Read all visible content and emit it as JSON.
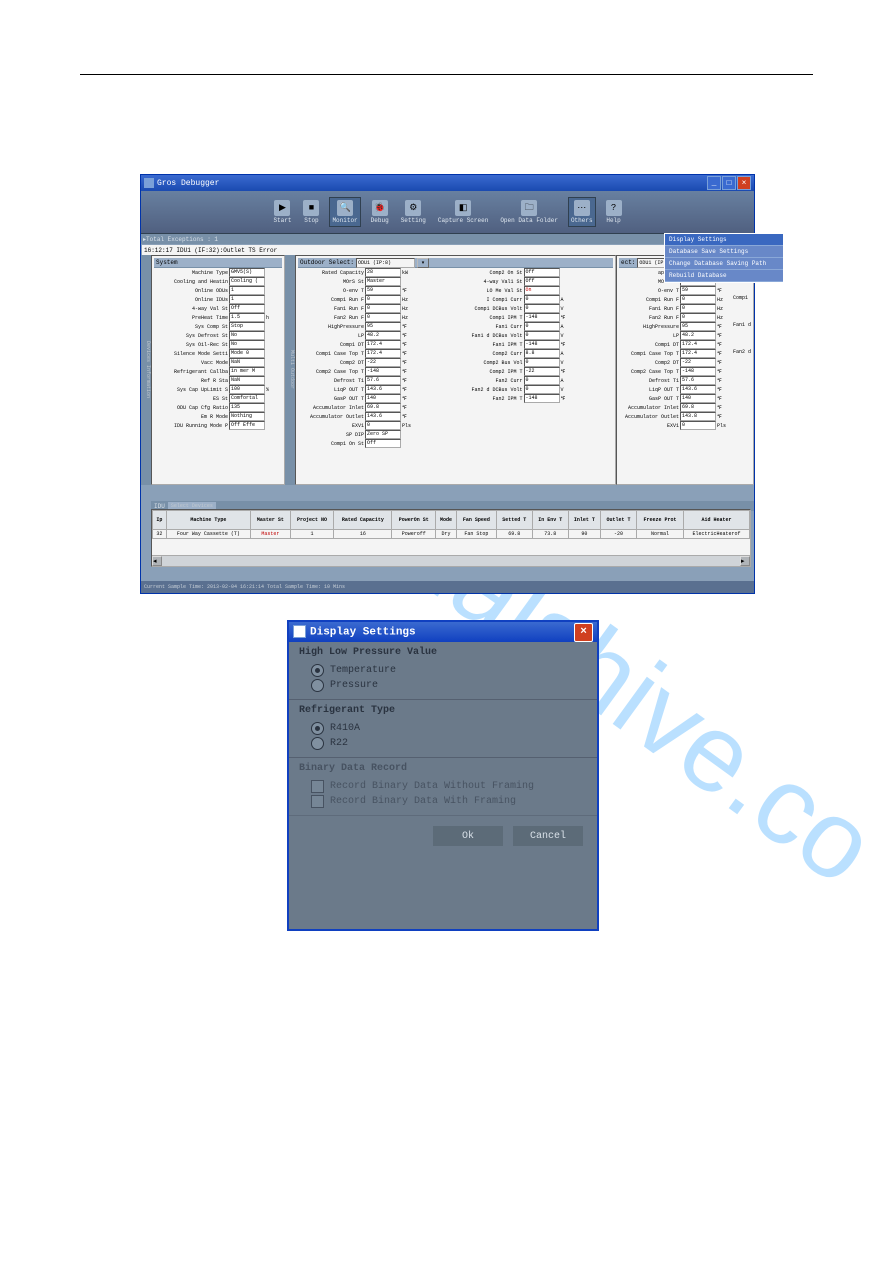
{
  "app": {
    "title": "Gros Debugger",
    "title_icon": "app-icon"
  },
  "winbtns": {
    "min": "_",
    "max": "□",
    "close": "×"
  },
  "toolbar": [
    {
      "key": "start",
      "label": "Start",
      "glyph": "▶"
    },
    {
      "key": "stop",
      "label": "Stop",
      "glyph": "■"
    },
    {
      "key": "monitor",
      "label": "Monitor",
      "glyph": "🔍",
      "selected": true
    },
    {
      "key": "debug",
      "label": "Debug",
      "glyph": "🐞"
    },
    {
      "key": "setting",
      "label": "Setting",
      "glyph": "⚙"
    },
    {
      "key": "capture",
      "label": "Capture Screen",
      "glyph": "◧"
    },
    {
      "key": "open",
      "label": "Open Data Folder",
      "glyph": "🗀"
    },
    {
      "key": "others",
      "label": "Others",
      "glyph": "⋯",
      "selected": true
    },
    {
      "key": "help",
      "label": "Help",
      "glyph": "?"
    }
  ],
  "exc": {
    "label": "Total Exceptions : 1",
    "msg": "16:12:17 IDU1 (IF:32):Outlet TS Error"
  },
  "menu": [
    {
      "label": "Display Settings",
      "hl": true
    },
    {
      "label": "Database Save Settings",
      "hl": false
    },
    {
      "label": "Change Database Saving Path",
      "hl": false
    },
    {
      "label": "Rebuild Database",
      "hl": false
    }
  ],
  "system": {
    "header": "System",
    "rows": [
      {
        "k": "Machine Type",
        "v": "GMV5(S)"
      },
      {
        "k": "Cooling and Heatin",
        "v": "Cooling (",
        "cls": ""
      },
      {
        "k": "Online ODUs",
        "v": "1"
      },
      {
        "k": "Online IDUs",
        "v": "1"
      },
      {
        "k": "4-way Val St",
        "v": "Off"
      },
      {
        "k": "PreHeat Time",
        "v": "1.5",
        "u": "h"
      },
      {
        "k": "Sys Comp St",
        "v": "Stop"
      },
      {
        "k": "Sys Defrost St",
        "v": "No"
      },
      {
        "k": "Sys Oil-Rec St",
        "v": "No"
      },
      {
        "k": "Silence Mode Setti",
        "v": "Mode 0"
      },
      {
        "k": "Vacc Mode",
        "v": "NaN"
      },
      {
        "k": "Refrigerant Callba",
        "v": "in mer M"
      },
      {
        "k": "Ref R Sta",
        "v": "NaN"
      },
      {
        "k": "Sys Cap UpLimit S",
        "v": "100",
        "u": "%"
      },
      {
        "k": "ES St",
        "v": "Comfortal"
      },
      {
        "k": "ODU Cap Cfg Ratio",
        "v": "135"
      },
      {
        "k": "Em R Mode",
        "v": "Nothing"
      },
      {
        "k": "IDU Running Mode P",
        "v": "Off Effe"
      }
    ]
  },
  "outdoor": {
    "header": "Outdoor Select:",
    "dd": "ODU1 (IP:8)",
    "col1": [
      {
        "k": "Rated Capacity",
        "v": "28",
        "u": "kW"
      },
      {
        "k": "MOrS St",
        "v": "Master"
      },
      {
        "k": "O-env T",
        "v": "59",
        "u": "℉"
      },
      {
        "k": "Comp1 Run F",
        "v": "0",
        "u": "Hz"
      },
      {
        "k": "Fan1 Run F",
        "v": "0",
        "u": "Hz"
      },
      {
        "k": "Fan2 Run F",
        "v": "0",
        "u": "Hz"
      },
      {
        "k": "HighPressure",
        "v": "95",
        "u": "℉"
      },
      {
        "k": "LP",
        "v": "48.2",
        "u": "℉"
      },
      {
        "k": "Comp1 DT",
        "v": "172.4",
        "u": "℉"
      },
      {
        "k": "Comp1 Case Top T",
        "v": "172.4",
        "u": "℉"
      },
      {
        "k": "Comp2 DT",
        "v": "-22",
        "u": "℉"
      },
      {
        "k": "Comp2 Case Top T",
        "v": "-148",
        "u": "℉"
      },
      {
        "k": "Defrost T1",
        "v": "57.6",
        "u": "℉"
      },
      {
        "k": "LiqP OUT T",
        "v": "143.6",
        "u": "℉"
      },
      {
        "k": "GasP OUT T",
        "v": "140",
        "u": "℉"
      },
      {
        "k": "Accumulator Inlet",
        "v": "69.8",
        "u": "℉"
      },
      {
        "k": "Accumulator Outlet",
        "v": "143.6",
        "u": "℉"
      },
      {
        "k": "EXV1",
        "v": "0",
        "u": "Pls"
      },
      {
        "k": "SP DIP",
        "v": "Zero SP"
      },
      {
        "k": "Comp1 On St",
        "v": "Off"
      }
    ],
    "col2": [
      {
        "k": "Comp2 On St",
        "v": "Off"
      },
      {
        "k": "4-way Val1 St",
        "v": "Off"
      },
      {
        "k": "LO Me Val St",
        "v": "On",
        "cls": "red"
      },
      {
        "k": "I Comp1 Curr",
        "v": "0",
        "u": "A"
      },
      {
        "k": "Comp1 DCBus Volt",
        "v": "0",
        "u": "V"
      },
      {
        "k": "Comp1 IPM T",
        "v": "-148",
        "u": "℉"
      },
      {
        "k": "Fan1 Curr",
        "v": "0",
        "u": "A"
      },
      {
        "k": "Fan1 d DCBus Volt",
        "v": "0",
        "u": "V"
      },
      {
        "k": "Fan1 IPM T",
        "v": "-148",
        "u": "℉"
      },
      {
        "k": "Comp2 Curr",
        "v": "8.8",
        "u": "A"
      },
      {
        "k": "Comp2 Bus Vol",
        "v": "0",
        "u": "V"
      },
      {
        "k": "Comp2 IPM T",
        "v": "-22",
        "u": "℉"
      },
      {
        "k": "Fan2 Curr",
        "v": "0",
        "u": "A"
      },
      {
        "k": "Fan2 d DCBus Volt",
        "v": "0",
        "u": "V"
      },
      {
        "k": "Fan2 IPM T",
        "v": "-148",
        "u": "℉"
      }
    ]
  },
  "outdoor2": {
    "header": "ect:",
    "dd": "ODU1 (IP:8)",
    "rows": [
      {
        "k": "apacity",
        "v": "28",
        "u": "kW"
      },
      {
        "k": "MOrS St",
        "v": "Master"
      },
      {
        "k": "O-env T",
        "v": "59",
        "u": "℉"
      },
      {
        "k": "Comp1 Run F",
        "v": "0",
        "u": "Hz"
      },
      {
        "k": "Fan1 Run F",
        "v": "0",
        "u": "Hz"
      },
      {
        "k": "Fan2 Run F",
        "v": "0",
        "u": "Hz"
      },
      {
        "k": "HighPressure",
        "v": "95",
        "u": "℉"
      },
      {
        "k": "LP",
        "v": "48.2",
        "u": "℉"
      },
      {
        "k": "Comp1 DT",
        "v": "172.4",
        "u": "℉"
      },
      {
        "k": "Comp1 Case Top T",
        "v": "172.4",
        "u": "℉"
      },
      {
        "k": "Comp2 DT",
        "v": "-22",
        "u": "℉"
      },
      {
        "k": "Comp2 Case Top T",
        "v": "-148",
        "u": "℉"
      },
      {
        "k": "Defrost T1",
        "v": "57.6",
        "u": "℉"
      },
      {
        "k": "LiqP OUT T",
        "v": "143.6",
        "u": "℉"
      },
      {
        "k": "GasP OUT T",
        "v": "140",
        "u": "℉"
      },
      {
        "k": "Accumulator Inlet",
        "v": "69.8",
        "u": "℉"
      },
      {
        "k": "Accumulator Outlet",
        "v": "143.8",
        "u": "℉"
      },
      {
        "k": "EXV1",
        "v": "0",
        "u": "Pls"
      }
    ],
    "side": [
      "4",
      "",
      "",
      "Comp1",
      "",
      "",
      "Fan1 d",
      "",
      "",
      "Fan2 d"
    ]
  },
  "idu": {
    "section": "IDU",
    "tab": "Select Devices",
    "cols": [
      "Ip",
      "Machine Type",
      "Master St",
      "Project NO",
      "Rated Capacity",
      "PowerOn St",
      "Mode",
      "Fan Speed",
      "Setted T",
      "In Env T",
      "Inlet T",
      "Outlet T",
      "Freeze Prot",
      "Aid Heater"
    ],
    "row": [
      "32",
      "Four Way Cassette (T)",
      "Master",
      "1",
      "16",
      "Poweroff",
      "Dry",
      "Fan Stop",
      "69.8",
      "73.8",
      "90",
      "-20",
      "Normal",
      "ElectricHeaterof"
    ]
  },
  "status": "Current Sample Time: 2013-02-04 16:21:14  Total Sample Time: 10 Mins",
  "dlg": {
    "title": "Display Settings",
    "sect1": {
      "hdr": "High Low Pressure Value",
      "opts": [
        "Temperature",
        "Pressure"
      ],
      "sel": 0
    },
    "sect2": {
      "hdr": "Refrigerant Type",
      "opts": [
        "R410A",
        "R22"
      ],
      "sel": 0
    },
    "sect3": {
      "hdr": "Binary Data Record",
      "opts": [
        "Record Binary Data Without Framing",
        "Record Binary Data With Framing"
      ]
    },
    "ok": "Ok",
    "cancel": "Cancel",
    "close": "×"
  },
  "watermark": "manualshive.co"
}
